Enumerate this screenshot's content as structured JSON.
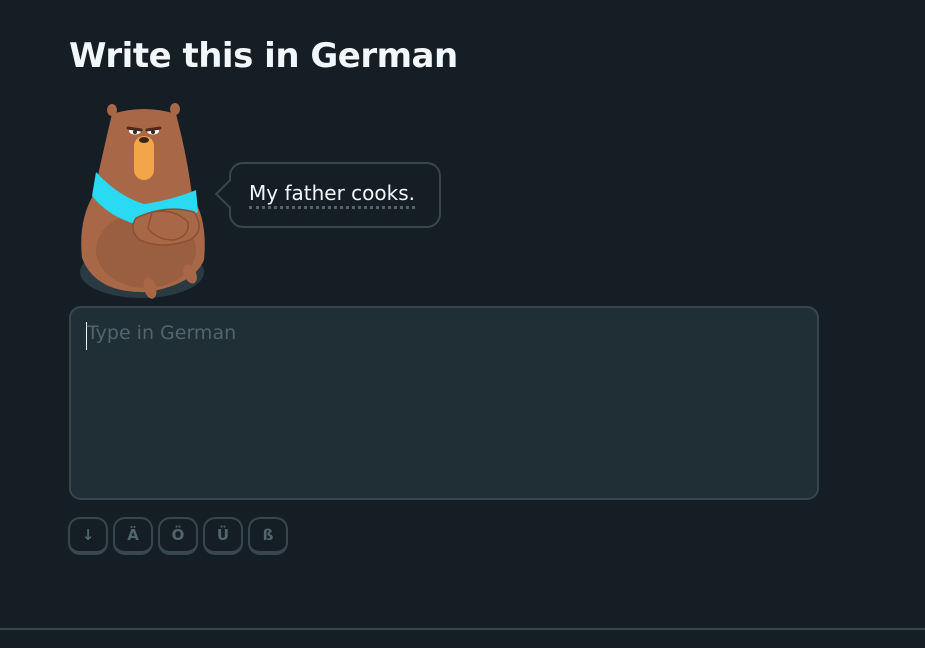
{
  "challenge": {
    "title": "Write this in German"
  },
  "prompt": {
    "sentence": "My father cooks."
  },
  "answer": {
    "value": "",
    "placeholder": "Type in German"
  },
  "keyboard": {
    "keys": [
      "↓",
      "Ä",
      "Ö",
      "Ü",
      "ß"
    ]
  },
  "colors": {
    "background": "#151e24",
    "panel": "#202f36",
    "border": "#37464f",
    "muted_text": "#52656d",
    "text": "#f1f7fb",
    "bear_fur": "#a86848",
    "bear_scarf": "#2ad9f2"
  },
  "icons": {
    "character": "bear-character"
  }
}
